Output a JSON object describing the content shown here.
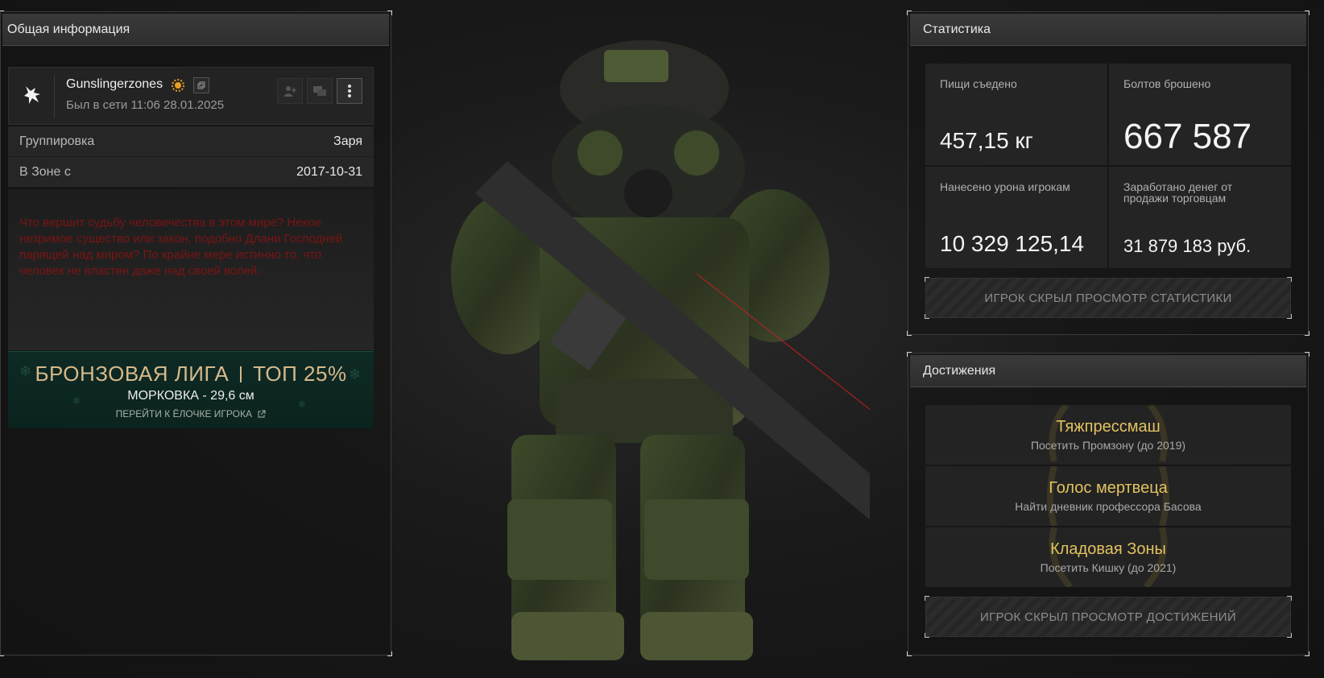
{
  "general": {
    "header": "Общая информация",
    "username": "Gunslingerzones",
    "last_seen": "Был в сети 11:06 28.01.2025",
    "rows": [
      {
        "label": "Группировка",
        "value": "Заря"
      },
      {
        "label": "В Зоне с",
        "value": "2017-10-31"
      }
    ],
    "bio": "Что вершит судьбу человечества в этом мире? Некое незримое существо или закон, подобно Длани Господней парящей над миром? По крайне мере истинно то, что человек не властен даже над своей волей.",
    "league": {
      "title_left": "БРОНЗОВАЯ ЛИГА",
      "title_right": "ТОП 25%",
      "subtitle": "МОРКОВКА - 29,6 см",
      "link": "ПЕРЕЙТИ К ЁЛОЧКЕ ИГРОКА"
    }
  },
  "stats": {
    "header": "Статистика",
    "cells": [
      {
        "label": "Пищи съедено",
        "value": "457,15 кг"
      },
      {
        "label": "Болтов брошено",
        "value": "667 587"
      },
      {
        "label": "Нанесено урона игрокам",
        "value": "10 329 125,14"
      },
      {
        "label": "Заработано денег от продажи торговцам",
        "value": "31 879 183 руб."
      }
    ],
    "hidden_notice": "ИГРОК СКРЫЛ ПРОСМОТР СТАТИСТИКИ"
  },
  "achievements": {
    "header": "Достижения",
    "items": [
      {
        "title": "Тяжпрессмаш",
        "desc": "Посетить Промзону (до 2019)"
      },
      {
        "title": "Голос мертвеца",
        "desc": "Найти дневник профессора Басова"
      },
      {
        "title": "Кладовая Зоны",
        "desc": "Посетить Кишку (до 2021)"
      }
    ],
    "hidden_notice": "ИГРОК СКРЫЛ ПРОСМОТР ДОСТИЖЕНИЙ"
  },
  "colors": {
    "league_gold": "#d7b98a",
    "achievement_gold": "#e2c25f",
    "bio_red": "#7a1414",
    "badge_orange": "#e8a020"
  },
  "icons": [
    "faction-logo-icon",
    "rank-badge-icon",
    "copy-icon",
    "add-friend-icon",
    "message-icon",
    "more-vert-icon",
    "external-link-icon"
  ]
}
